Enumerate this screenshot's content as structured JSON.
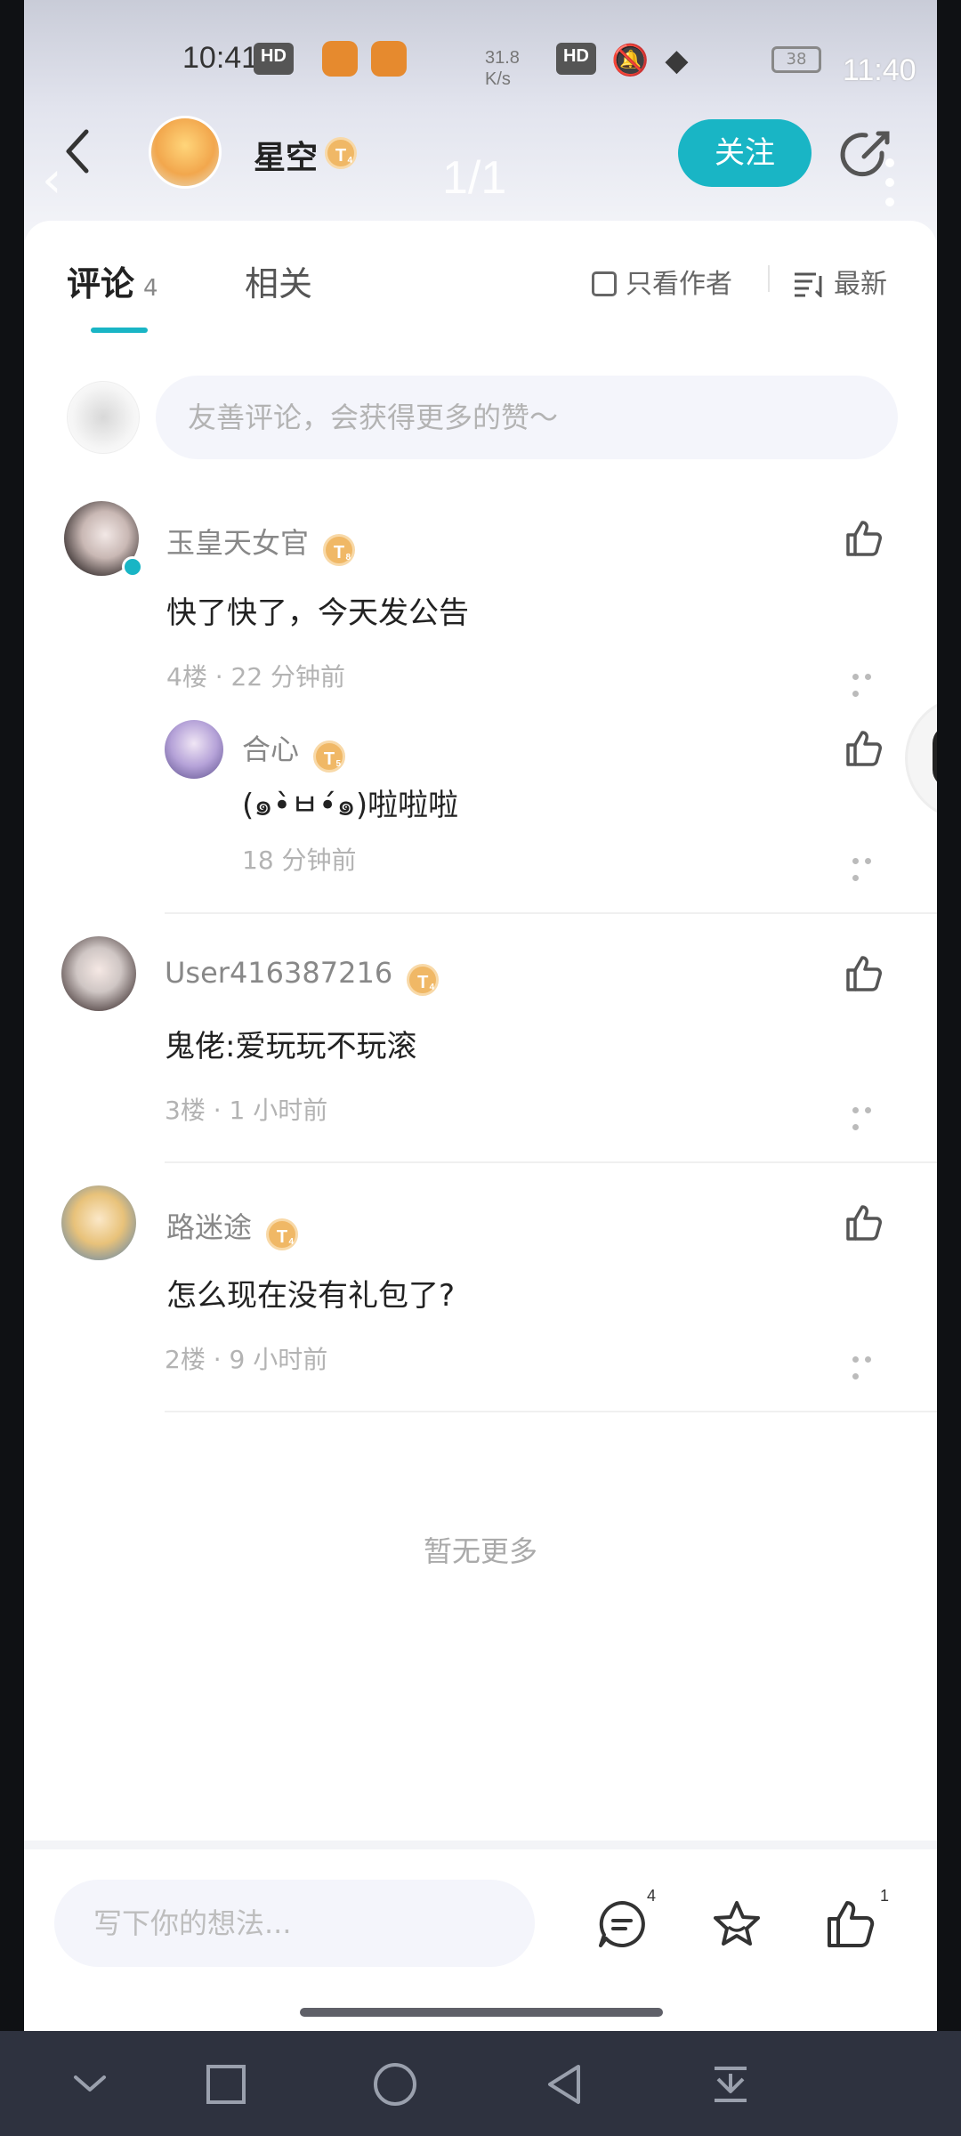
{
  "status_bar": {
    "time": "10:41",
    "chip_left": "HD",
    "speed": "31.8",
    "speed_unit": "K/s",
    "chip_right": "HD",
    "battery": "38",
    "time_overlay": "11:40"
  },
  "header": {
    "author_name": "星空",
    "author_level": "T",
    "author_level_num": "4",
    "page_indicator": "1/1",
    "follow_label": "关注"
  },
  "tabs": {
    "comments_label": "评论",
    "comments_count": "4",
    "related_label": "相关",
    "only_author_label": "只看作者",
    "sort_label": "最新"
  },
  "comment_input": {
    "placeholder": "友善评论，会获得更多的赞～"
  },
  "comments": [
    {
      "name": "玉皇天女官",
      "level": "T",
      "level_num": "8",
      "text": "快了快了，今天发公告",
      "meta": "4楼 · 22 分钟前",
      "reply": {
        "name": "合心",
        "level": "T",
        "level_num": "5",
        "text": "(๑•̀ㅂ•́๑)啦啦啦",
        "meta": "18 分钟前"
      }
    },
    {
      "name": "User416387216",
      "level": "T",
      "level_num": "4",
      "text": "鬼佬:爱玩玩不玩滚",
      "meta": "3楼 · 1 小时前"
    },
    {
      "name": "路迷途",
      "level": "T",
      "level_num": "4",
      "text": "怎么现在没有礼包了?",
      "meta": "2楼 · 9 小时前"
    }
  ],
  "no_more_text": "暂无更多",
  "bottom_bar": {
    "placeholder": "写下你的想法...",
    "comment_count": "4",
    "like_count": "1"
  },
  "colors": {
    "accent": "#19b5c5",
    "badge": "#f0b866",
    "nav_bar": "#2e323f"
  },
  "icons": [
    "back-arrow-icon",
    "share-icon",
    "checkbox-icon",
    "sort-icon",
    "like-icon",
    "more-icon",
    "comment-icon",
    "star-icon",
    "penguin-icon",
    "nav-down-icon",
    "nav-square-icon",
    "nav-circle-icon",
    "nav-back-icon",
    "nav-menu-icon"
  ]
}
